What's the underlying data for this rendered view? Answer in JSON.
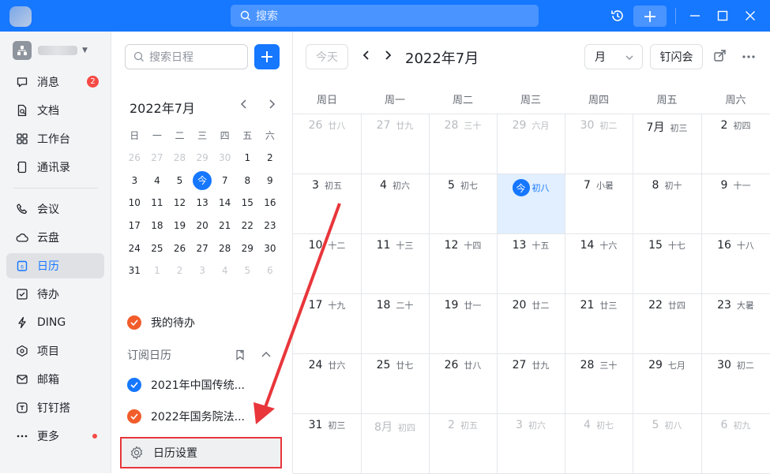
{
  "titlebar": {
    "search_placeholder": "搜索",
    "accent": "#1677ff"
  },
  "sidebar": {
    "items": [
      {
        "label": "消息",
        "icon": "message-icon",
        "badge": "2"
      },
      {
        "label": "文档",
        "icon": "doc-icon"
      },
      {
        "label": "工作台",
        "icon": "workbench-icon"
      },
      {
        "label": "通讯录",
        "icon": "contacts-icon"
      },
      {
        "label": "会议",
        "icon": "phone-icon"
      },
      {
        "label": "云盘",
        "icon": "cloud-icon"
      },
      {
        "label": "日历",
        "icon": "calendar-icon"
      },
      {
        "label": "待办",
        "icon": "todo-icon"
      },
      {
        "label": "DING",
        "icon": "ding-icon"
      },
      {
        "label": "项目",
        "icon": "project-icon"
      },
      {
        "label": "邮箱",
        "icon": "mail-icon"
      },
      {
        "label": "钉钉搭",
        "icon": "builder-icon"
      },
      {
        "label": "更多",
        "icon": "more-icon"
      }
    ],
    "active_item": "日历"
  },
  "calpanel": {
    "search_placeholder": "搜索日程",
    "mini_title": "2022年7月",
    "weekdays": [
      "日",
      "一",
      "二",
      "三",
      "四",
      "五",
      "六"
    ],
    "mini_days": [
      "26",
      "27",
      "28",
      "29",
      "30",
      "1",
      "2",
      "3",
      "4",
      "5",
      "今",
      "7",
      "8",
      "9",
      "10",
      "11",
      "12",
      "13",
      "14",
      "15",
      "16",
      "17",
      "18",
      "19",
      "20",
      "21",
      "22",
      "23",
      "24",
      "25",
      "26",
      "27",
      "28",
      "29",
      "30",
      "31",
      "1",
      "2",
      "3",
      "4",
      "5",
      "6"
    ],
    "todo_label": "我的待办",
    "subscribed_header": "订阅日历",
    "subscriptions": [
      {
        "label": "2021年中国传统...",
        "color": "#1677ff"
      },
      {
        "label": "2022年国务院法...",
        "color": "#f25c2b"
      }
    ],
    "todo_color": "#f25c2b",
    "settings_label": "日历设置"
  },
  "main": {
    "today_button": "今天",
    "title": "2022年7月",
    "view_select": "月",
    "flash_meeting": "钉闪会",
    "weekday_headers": [
      "周日",
      "周一",
      "周二",
      "周三",
      "周四",
      "周五",
      "周六"
    ],
    "weeks": [
      [
        {
          "d": "26",
          "l": "廿八",
          "om": true
        },
        {
          "d": "27",
          "l": "廿九",
          "om": true
        },
        {
          "d": "28",
          "l": "三十",
          "om": true
        },
        {
          "d": "29",
          "l": "六月",
          "om": true
        },
        {
          "d": "30",
          "l": "初二",
          "om": true
        },
        {
          "d": "7月",
          "l": "初三"
        },
        {
          "d": "2",
          "l": "初四"
        }
      ],
      [
        {
          "d": "3",
          "l": "初五"
        },
        {
          "d": "4",
          "l": "初六"
        },
        {
          "d": "5",
          "l": "初七"
        },
        {
          "d": "今",
          "l": "初八",
          "today": true
        },
        {
          "d": "7",
          "l": "小暑"
        },
        {
          "d": "8",
          "l": "初十"
        },
        {
          "d": "9",
          "l": "十一"
        }
      ],
      [
        {
          "d": "10",
          "l": "十二"
        },
        {
          "d": "11",
          "l": "十三"
        },
        {
          "d": "12",
          "l": "十四"
        },
        {
          "d": "13",
          "l": "十五"
        },
        {
          "d": "14",
          "l": "十六"
        },
        {
          "d": "15",
          "l": "十七"
        },
        {
          "d": "16",
          "l": "十八"
        }
      ],
      [
        {
          "d": "17",
          "l": "十九"
        },
        {
          "d": "18",
          "l": "二十"
        },
        {
          "d": "19",
          "l": "廿一"
        },
        {
          "d": "20",
          "l": "廿二"
        },
        {
          "d": "21",
          "l": "廿三"
        },
        {
          "d": "22",
          "l": "廿四"
        },
        {
          "d": "23",
          "l": "大暑"
        }
      ],
      [
        {
          "d": "24",
          "l": "廿六"
        },
        {
          "d": "25",
          "l": "廿七"
        },
        {
          "d": "26",
          "l": "廿八"
        },
        {
          "d": "27",
          "l": "廿九"
        },
        {
          "d": "28",
          "l": "三十"
        },
        {
          "d": "29",
          "l": "七月"
        },
        {
          "d": "30",
          "l": "初二"
        }
      ],
      [
        {
          "d": "31",
          "l": "初三",
          "strong": true
        },
        {
          "d": "8月",
          "l": "初四",
          "om": true
        },
        {
          "d": "2",
          "l": "初五",
          "om": true
        },
        {
          "d": "3",
          "l": "初六",
          "om": true
        },
        {
          "d": "4",
          "l": "初七",
          "om": true
        },
        {
          "d": "5",
          "l": "初八",
          "om": true
        },
        {
          "d": "6",
          "l": "初九",
          "om": true
        }
      ]
    ]
  },
  "annotation_color": "#e8363b"
}
